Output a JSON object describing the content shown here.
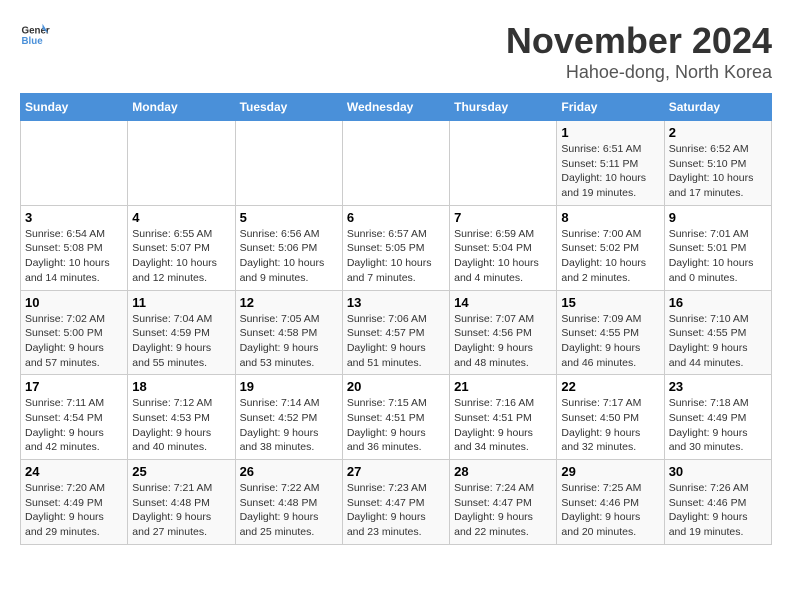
{
  "logo": {
    "line1": "General",
    "line2": "Blue"
  },
  "title": "November 2024",
  "location": "Hahoe-dong, North Korea",
  "days_header": [
    "Sunday",
    "Monday",
    "Tuesday",
    "Wednesday",
    "Thursday",
    "Friday",
    "Saturday"
  ],
  "weeks": [
    [
      {
        "day": "",
        "details": ""
      },
      {
        "day": "",
        "details": ""
      },
      {
        "day": "",
        "details": ""
      },
      {
        "day": "",
        "details": ""
      },
      {
        "day": "",
        "details": ""
      },
      {
        "day": "1",
        "details": "Sunrise: 6:51 AM\nSunset: 5:11 PM\nDaylight: 10 hours and 19 minutes."
      },
      {
        "day": "2",
        "details": "Sunrise: 6:52 AM\nSunset: 5:10 PM\nDaylight: 10 hours and 17 minutes."
      }
    ],
    [
      {
        "day": "3",
        "details": "Sunrise: 6:54 AM\nSunset: 5:08 PM\nDaylight: 10 hours and 14 minutes."
      },
      {
        "day": "4",
        "details": "Sunrise: 6:55 AM\nSunset: 5:07 PM\nDaylight: 10 hours and 12 minutes."
      },
      {
        "day": "5",
        "details": "Sunrise: 6:56 AM\nSunset: 5:06 PM\nDaylight: 10 hours and 9 minutes."
      },
      {
        "day": "6",
        "details": "Sunrise: 6:57 AM\nSunset: 5:05 PM\nDaylight: 10 hours and 7 minutes."
      },
      {
        "day": "7",
        "details": "Sunrise: 6:59 AM\nSunset: 5:04 PM\nDaylight: 10 hours and 4 minutes."
      },
      {
        "day": "8",
        "details": "Sunrise: 7:00 AM\nSunset: 5:02 PM\nDaylight: 10 hours and 2 minutes."
      },
      {
        "day": "9",
        "details": "Sunrise: 7:01 AM\nSunset: 5:01 PM\nDaylight: 10 hours and 0 minutes."
      }
    ],
    [
      {
        "day": "10",
        "details": "Sunrise: 7:02 AM\nSunset: 5:00 PM\nDaylight: 9 hours and 57 minutes."
      },
      {
        "day": "11",
        "details": "Sunrise: 7:04 AM\nSunset: 4:59 PM\nDaylight: 9 hours and 55 minutes."
      },
      {
        "day": "12",
        "details": "Sunrise: 7:05 AM\nSunset: 4:58 PM\nDaylight: 9 hours and 53 minutes."
      },
      {
        "day": "13",
        "details": "Sunrise: 7:06 AM\nSunset: 4:57 PM\nDaylight: 9 hours and 51 minutes."
      },
      {
        "day": "14",
        "details": "Sunrise: 7:07 AM\nSunset: 4:56 PM\nDaylight: 9 hours and 48 minutes."
      },
      {
        "day": "15",
        "details": "Sunrise: 7:09 AM\nSunset: 4:55 PM\nDaylight: 9 hours and 46 minutes."
      },
      {
        "day": "16",
        "details": "Sunrise: 7:10 AM\nSunset: 4:55 PM\nDaylight: 9 hours and 44 minutes."
      }
    ],
    [
      {
        "day": "17",
        "details": "Sunrise: 7:11 AM\nSunset: 4:54 PM\nDaylight: 9 hours and 42 minutes."
      },
      {
        "day": "18",
        "details": "Sunrise: 7:12 AM\nSunset: 4:53 PM\nDaylight: 9 hours and 40 minutes."
      },
      {
        "day": "19",
        "details": "Sunrise: 7:14 AM\nSunset: 4:52 PM\nDaylight: 9 hours and 38 minutes."
      },
      {
        "day": "20",
        "details": "Sunrise: 7:15 AM\nSunset: 4:51 PM\nDaylight: 9 hours and 36 minutes."
      },
      {
        "day": "21",
        "details": "Sunrise: 7:16 AM\nSunset: 4:51 PM\nDaylight: 9 hours and 34 minutes."
      },
      {
        "day": "22",
        "details": "Sunrise: 7:17 AM\nSunset: 4:50 PM\nDaylight: 9 hours and 32 minutes."
      },
      {
        "day": "23",
        "details": "Sunrise: 7:18 AM\nSunset: 4:49 PM\nDaylight: 9 hours and 30 minutes."
      }
    ],
    [
      {
        "day": "24",
        "details": "Sunrise: 7:20 AM\nSunset: 4:49 PM\nDaylight: 9 hours and 29 minutes."
      },
      {
        "day": "25",
        "details": "Sunrise: 7:21 AM\nSunset: 4:48 PM\nDaylight: 9 hours and 27 minutes."
      },
      {
        "day": "26",
        "details": "Sunrise: 7:22 AM\nSunset: 4:48 PM\nDaylight: 9 hours and 25 minutes."
      },
      {
        "day": "27",
        "details": "Sunrise: 7:23 AM\nSunset: 4:47 PM\nDaylight: 9 hours and 23 minutes."
      },
      {
        "day": "28",
        "details": "Sunrise: 7:24 AM\nSunset: 4:47 PM\nDaylight: 9 hours and 22 minutes."
      },
      {
        "day": "29",
        "details": "Sunrise: 7:25 AM\nSunset: 4:46 PM\nDaylight: 9 hours and 20 minutes."
      },
      {
        "day": "30",
        "details": "Sunrise: 7:26 AM\nSunset: 4:46 PM\nDaylight: 9 hours and 19 minutes."
      }
    ]
  ]
}
